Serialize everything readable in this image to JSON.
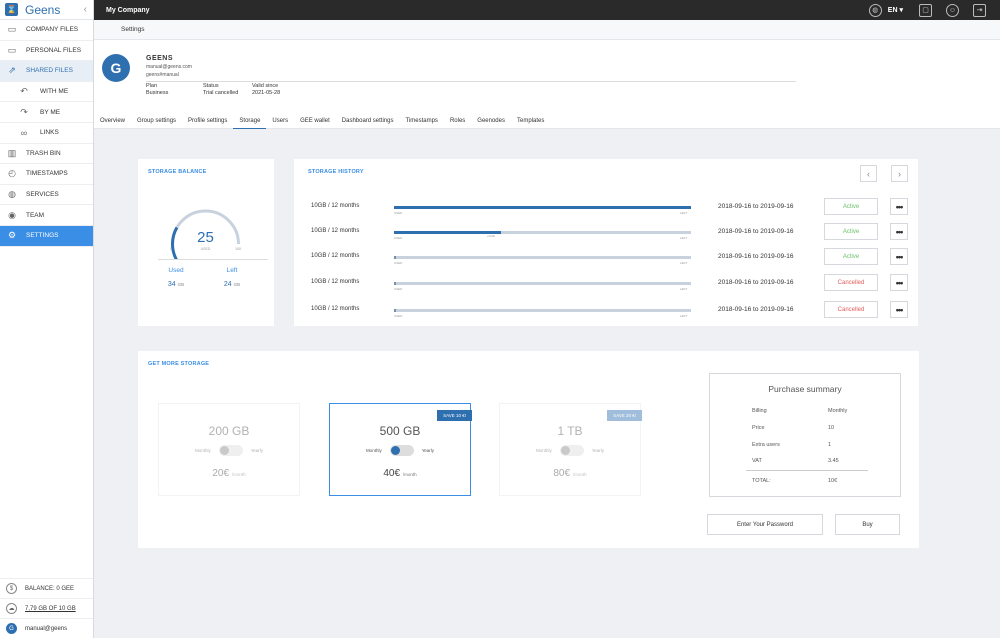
{
  "app": {
    "name": "Geens",
    "company": "My Company",
    "language": "EN"
  },
  "sidebar": {
    "items": [
      {
        "label": "COMPANY FILES",
        "icon": "folder-icon"
      },
      {
        "label": "PERSONAL FILES",
        "icon": "folder-icon"
      },
      {
        "label": "SHARED FILES",
        "icon": "share-icon"
      },
      {
        "label": "WITH ME",
        "icon": "arrow-left-icon"
      },
      {
        "label": "BY ME",
        "icon": "arrow-right-icon"
      },
      {
        "label": "LINKS",
        "icon": "link-icon"
      },
      {
        "label": "TRASH BIN",
        "icon": "trash-icon"
      },
      {
        "label": "TIMESTAMPS",
        "icon": "clock-icon"
      },
      {
        "label": "SERVICES",
        "icon": "globe-icon"
      },
      {
        "label": "TEAM",
        "icon": "team-icon"
      },
      {
        "label": "SETTINGS",
        "icon": "gear-icon"
      }
    ],
    "bottom": {
      "balance": "BALANCE: 0 GEE",
      "storage": "7,79 GB OF 10 GB",
      "user": "manual@geens"
    }
  },
  "breadcrumb": "Settings",
  "profile": {
    "initial": "G",
    "name": "GEENS",
    "email": "manual@geens.com",
    "username": "geens#manual",
    "plan_label": "Plan",
    "plan_value": "Business",
    "status_label": "Status",
    "status_value": "Trial cancelled",
    "valid_label": "Valid since",
    "valid_value": "2021-05-28"
  },
  "tabs": [
    "Overview",
    "Group settings",
    "Profile settings",
    "Storage",
    "Users",
    "GEE wallet",
    "Dashboard settings",
    "Timestamps",
    "Roles",
    "Geenodes",
    "Templates"
  ],
  "storage_balance": {
    "title": "STORAGE BALANCE",
    "value": "25",
    "used_fraction": 0.25,
    "unit": "USED",
    "min": "0",
    "max": "100",
    "used_label": "Used",
    "used_value": "34",
    "left_label": "Left",
    "left_value": "24",
    "gb": "GB"
  },
  "storage_history": {
    "title": "STORAGE HISTORY",
    "rows": [
      {
        "label": "10GB / 12 months",
        "fill": 1.0,
        "left": "USED",
        "right": "LEFT",
        "mark": "",
        "date": "2018-09-16 to 2019-09-16",
        "status": "Active",
        "status_kind": "ok"
      },
      {
        "label": "10GB / 12 months",
        "fill": 0.36,
        "left": "USED",
        "right": "LEFT",
        "mark": "+NCE",
        "date": "2018-09-16 to 2019-09-16",
        "status": "Active",
        "status_kind": "ok"
      },
      {
        "label": "10GB / 12 months",
        "fill": 0.0,
        "left": "USED",
        "right": "LEFT",
        "mark": "",
        "date": "2018-09-16 to 2019-09-16",
        "status": "Active",
        "status_kind": "ok"
      },
      {
        "label": "10GB / 12 months",
        "fill": 0.0,
        "left": "USED",
        "right": "LEFT",
        "mark": "",
        "date": "2018-09-16 to 2019-09-16",
        "status": "Cancelled",
        "status_kind": "cancel"
      },
      {
        "label": "10GB / 12 months",
        "fill": 0.0,
        "left": "USED",
        "right": "LEFT",
        "mark": "",
        "date": "2018-09-16 to 2019-09-16",
        "status": "Cancelled",
        "status_kind": "cancel"
      }
    ],
    "more": "•••"
  },
  "more_storage": {
    "title": "GET MORE STORAGE",
    "plans": [
      {
        "size": "200 GB",
        "monthly": "Monthly",
        "yearly": "Yearly",
        "price": "20€",
        "per": "/month",
        "badge": "",
        "state": "dim"
      },
      {
        "size": "500 GB",
        "monthly": "Monthly",
        "yearly": "Yearly",
        "price": "40€",
        "per": "/month",
        "badge": "SAVE 10 €!",
        "state": "selected"
      },
      {
        "size": "1 TB",
        "monthly": "Monthly",
        "yearly": "Yearly",
        "price": "80€",
        "per": "/month",
        "badge": "SAVE 20 €!",
        "state": "dim"
      }
    ],
    "summary": {
      "title": "Purchase summary",
      "rows": [
        {
          "k": "Billing",
          "v": "Monthly"
        },
        {
          "k": "Price",
          "v": "10"
        },
        {
          "k": "Extra users",
          "v": "1"
        },
        {
          "k": "VAT",
          "v": "3.45"
        },
        {
          "k": "TOTAL:",
          "v": "10€"
        }
      ]
    },
    "password_button": "Enter Your Password",
    "buy_button": "Buy"
  },
  "colors": {
    "accent": "#3a8ee6",
    "brand": "#2e6fb0",
    "active": "#6cc06c",
    "cancelled": "#e45c5c"
  }
}
